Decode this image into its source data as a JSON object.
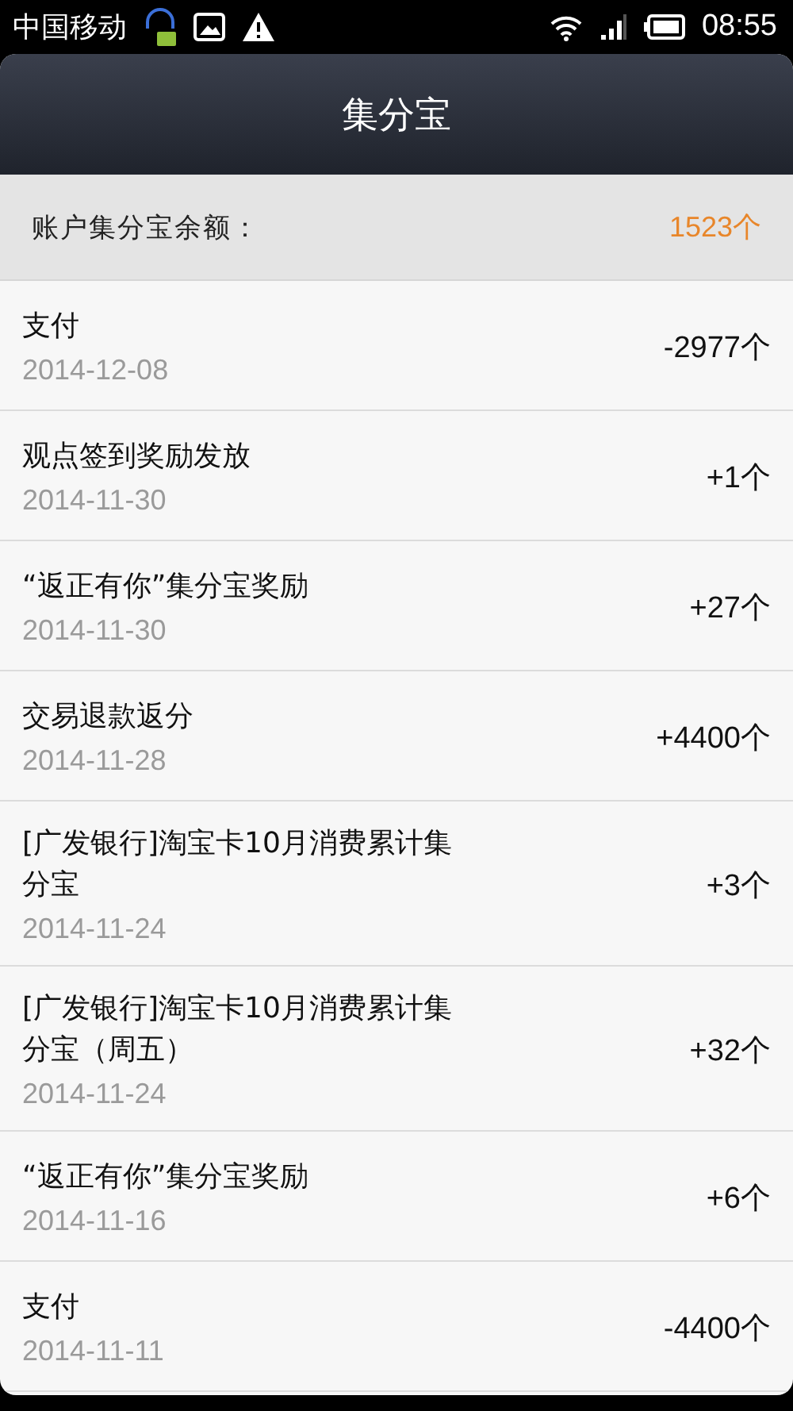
{
  "status_bar": {
    "carrier": "中国移动",
    "time": "08:55"
  },
  "header": {
    "title": "集分宝"
  },
  "balance": {
    "label": "账户集分宝余额：",
    "amount": "1523个"
  },
  "records": [
    {
      "title": "支付",
      "date": "2014-12-08",
      "amount": "-2977个"
    },
    {
      "title": "观点签到奖励发放",
      "date": "2014-11-30",
      "amount": "+1个"
    },
    {
      "title": "“返正有你”集分宝奖励",
      "date": "2014-11-30",
      "amount": "+27个"
    },
    {
      "title": "交易退款返分",
      "date": "2014-11-28",
      "amount": "+4400个"
    },
    {
      "title": "[广发银行]淘宝卡10月消费累计集分宝",
      "date": "2014-11-24",
      "amount": "+3个"
    },
    {
      "title": "[广发银行]淘宝卡10月消费累计集分宝（周五）",
      "date": "2014-11-24",
      "amount": "+32个"
    },
    {
      "title": "“返正有你”集分宝奖励",
      "date": "2014-11-16",
      "amount": "+6个"
    },
    {
      "title": "支付",
      "date": "2014-11-11",
      "amount": "-4400个"
    }
  ]
}
